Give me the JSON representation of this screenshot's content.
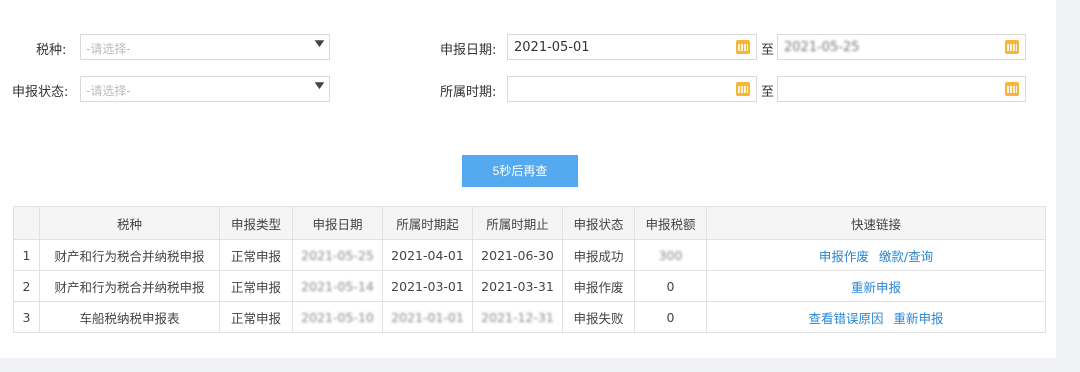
{
  "filters": {
    "tax_type_label": "税种:",
    "tax_type_placeholder": "-请选择-",
    "status_label": "申报状态:",
    "status_placeholder": "-请选择-",
    "declare_date_label": "申报日期:",
    "declare_date_from": "2021-05-01",
    "declare_date_to": "2021-05-25",
    "period_label": "所属时期:",
    "period_from": "",
    "period_to": "",
    "to_label": "至"
  },
  "query_button": "5秒后再查",
  "table": {
    "headers": [
      "",
      "税种",
      "申报类型",
      "申报日期",
      "所属时期起",
      "所属时期止",
      "申报状态",
      "申报税额",
      "快速链接"
    ],
    "rows": [
      {
        "idx": "1",
        "tax": "财产和行为税合并纳税申报",
        "type": "正常申报",
        "date": "2021-05-25",
        "start": "2021-04-01",
        "end": "2021-06-30",
        "status": "申报成功",
        "amount": "300",
        "links": [
          "申报作废",
          "缴款/查询"
        ]
      },
      {
        "idx": "2",
        "tax": "财产和行为税合并纳税申报",
        "type": "正常申报",
        "date": "2021-05-14",
        "start": "2021-03-01",
        "end": "2021-03-31",
        "status": "申报作废",
        "amount": "0",
        "links": [
          "重新申报"
        ]
      },
      {
        "idx": "3",
        "tax": "车船税纳税申报表",
        "type": "正常申报",
        "date": "2021-05-10",
        "start": "2021-01-01",
        "end": "2021-12-31",
        "status": "申报失败",
        "amount": "0",
        "links": [
          "查看错误原因",
          "重新申报"
        ]
      }
    ]
  },
  "icons": {
    "calendar": "calendar-icon",
    "dropdown": "caret-down-icon"
  },
  "colors": {
    "accent": "#55a9ef",
    "link": "#2a86d6",
    "calendar": "#f5b63a"
  }
}
